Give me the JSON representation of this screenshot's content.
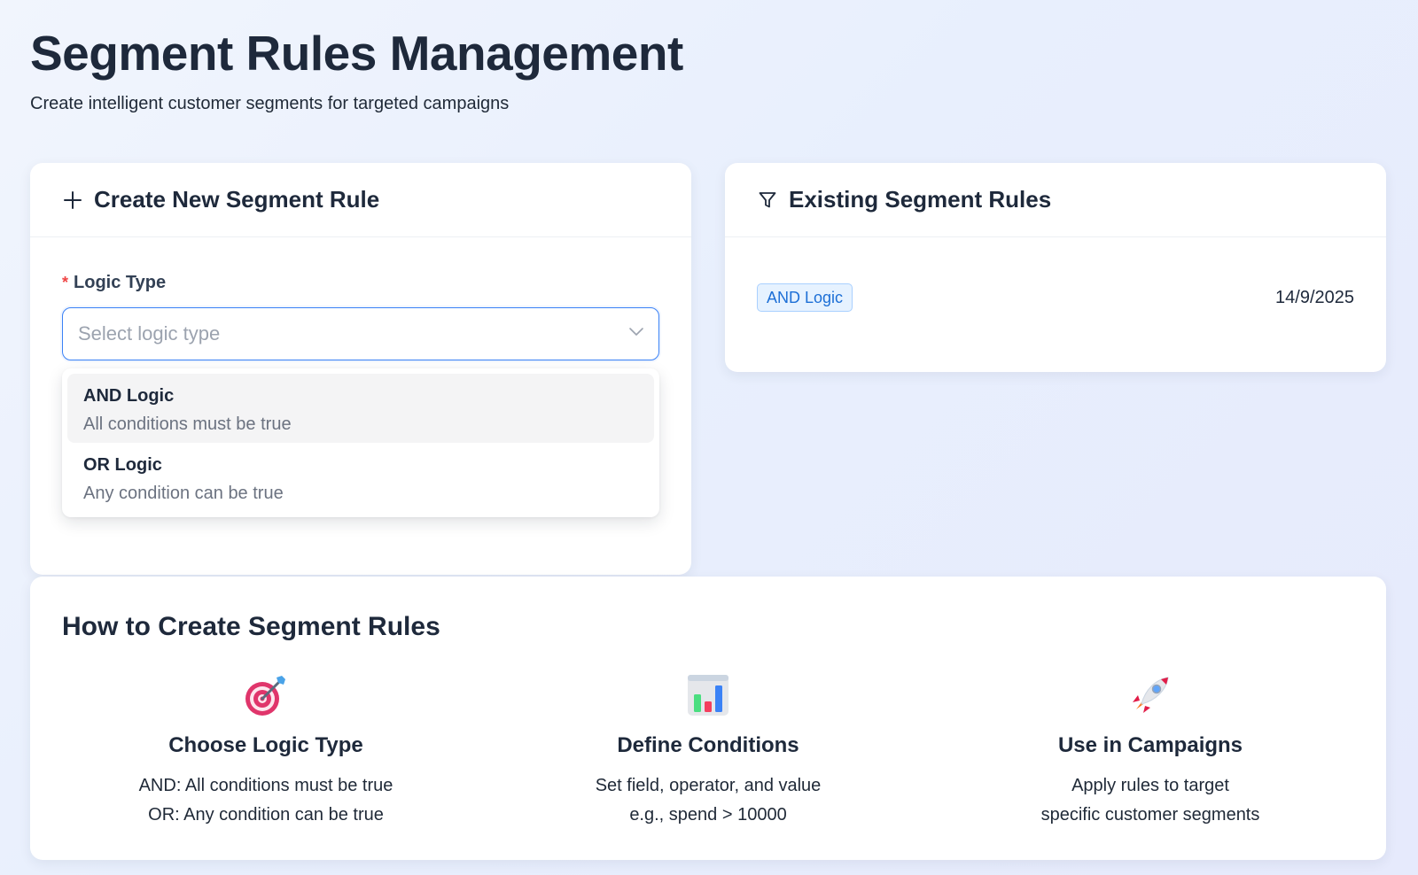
{
  "header": {
    "title": "Segment Rules Management",
    "subtitle": "Create intelligent customer segments for targeted campaigns"
  },
  "create_card": {
    "title": "Create New Segment Rule",
    "icon": "plus-icon",
    "field": {
      "required_mark": "*",
      "label": "Logic Type",
      "placeholder": "Select logic type",
      "icon": "chevron-down-icon"
    },
    "options": [
      {
        "title": "AND Logic",
        "desc": "All conditions must be true"
      },
      {
        "title": "OR Logic",
        "desc": "Any condition can be true"
      }
    ]
  },
  "existing_card": {
    "title": "Existing Segment Rules",
    "icon": "filter-icon",
    "rules": [
      {
        "tag": "AND Logic",
        "date": "14/9/2025"
      }
    ]
  },
  "howto": {
    "title": "How to Create Segment Rules",
    "steps": [
      {
        "icon": "target-icon",
        "title": "Choose Logic Type",
        "line1": "AND: All conditions must be true",
        "line2": "OR: Any condition can be true"
      },
      {
        "icon": "bar-chart-icon",
        "title": "Define Conditions",
        "line1": "Set field, operator, and value",
        "line2": "e.g., spend > 10000"
      },
      {
        "icon": "rocket-icon",
        "title": "Use in Campaigns",
        "line1": "Apply rules to target",
        "line2": "specific customer segments"
      }
    ]
  },
  "colors": {
    "accent": "#3b82f6",
    "tag_text": "#1d6fd6",
    "tag_bg": "#e6f2ff",
    "required": "#ef4444"
  }
}
